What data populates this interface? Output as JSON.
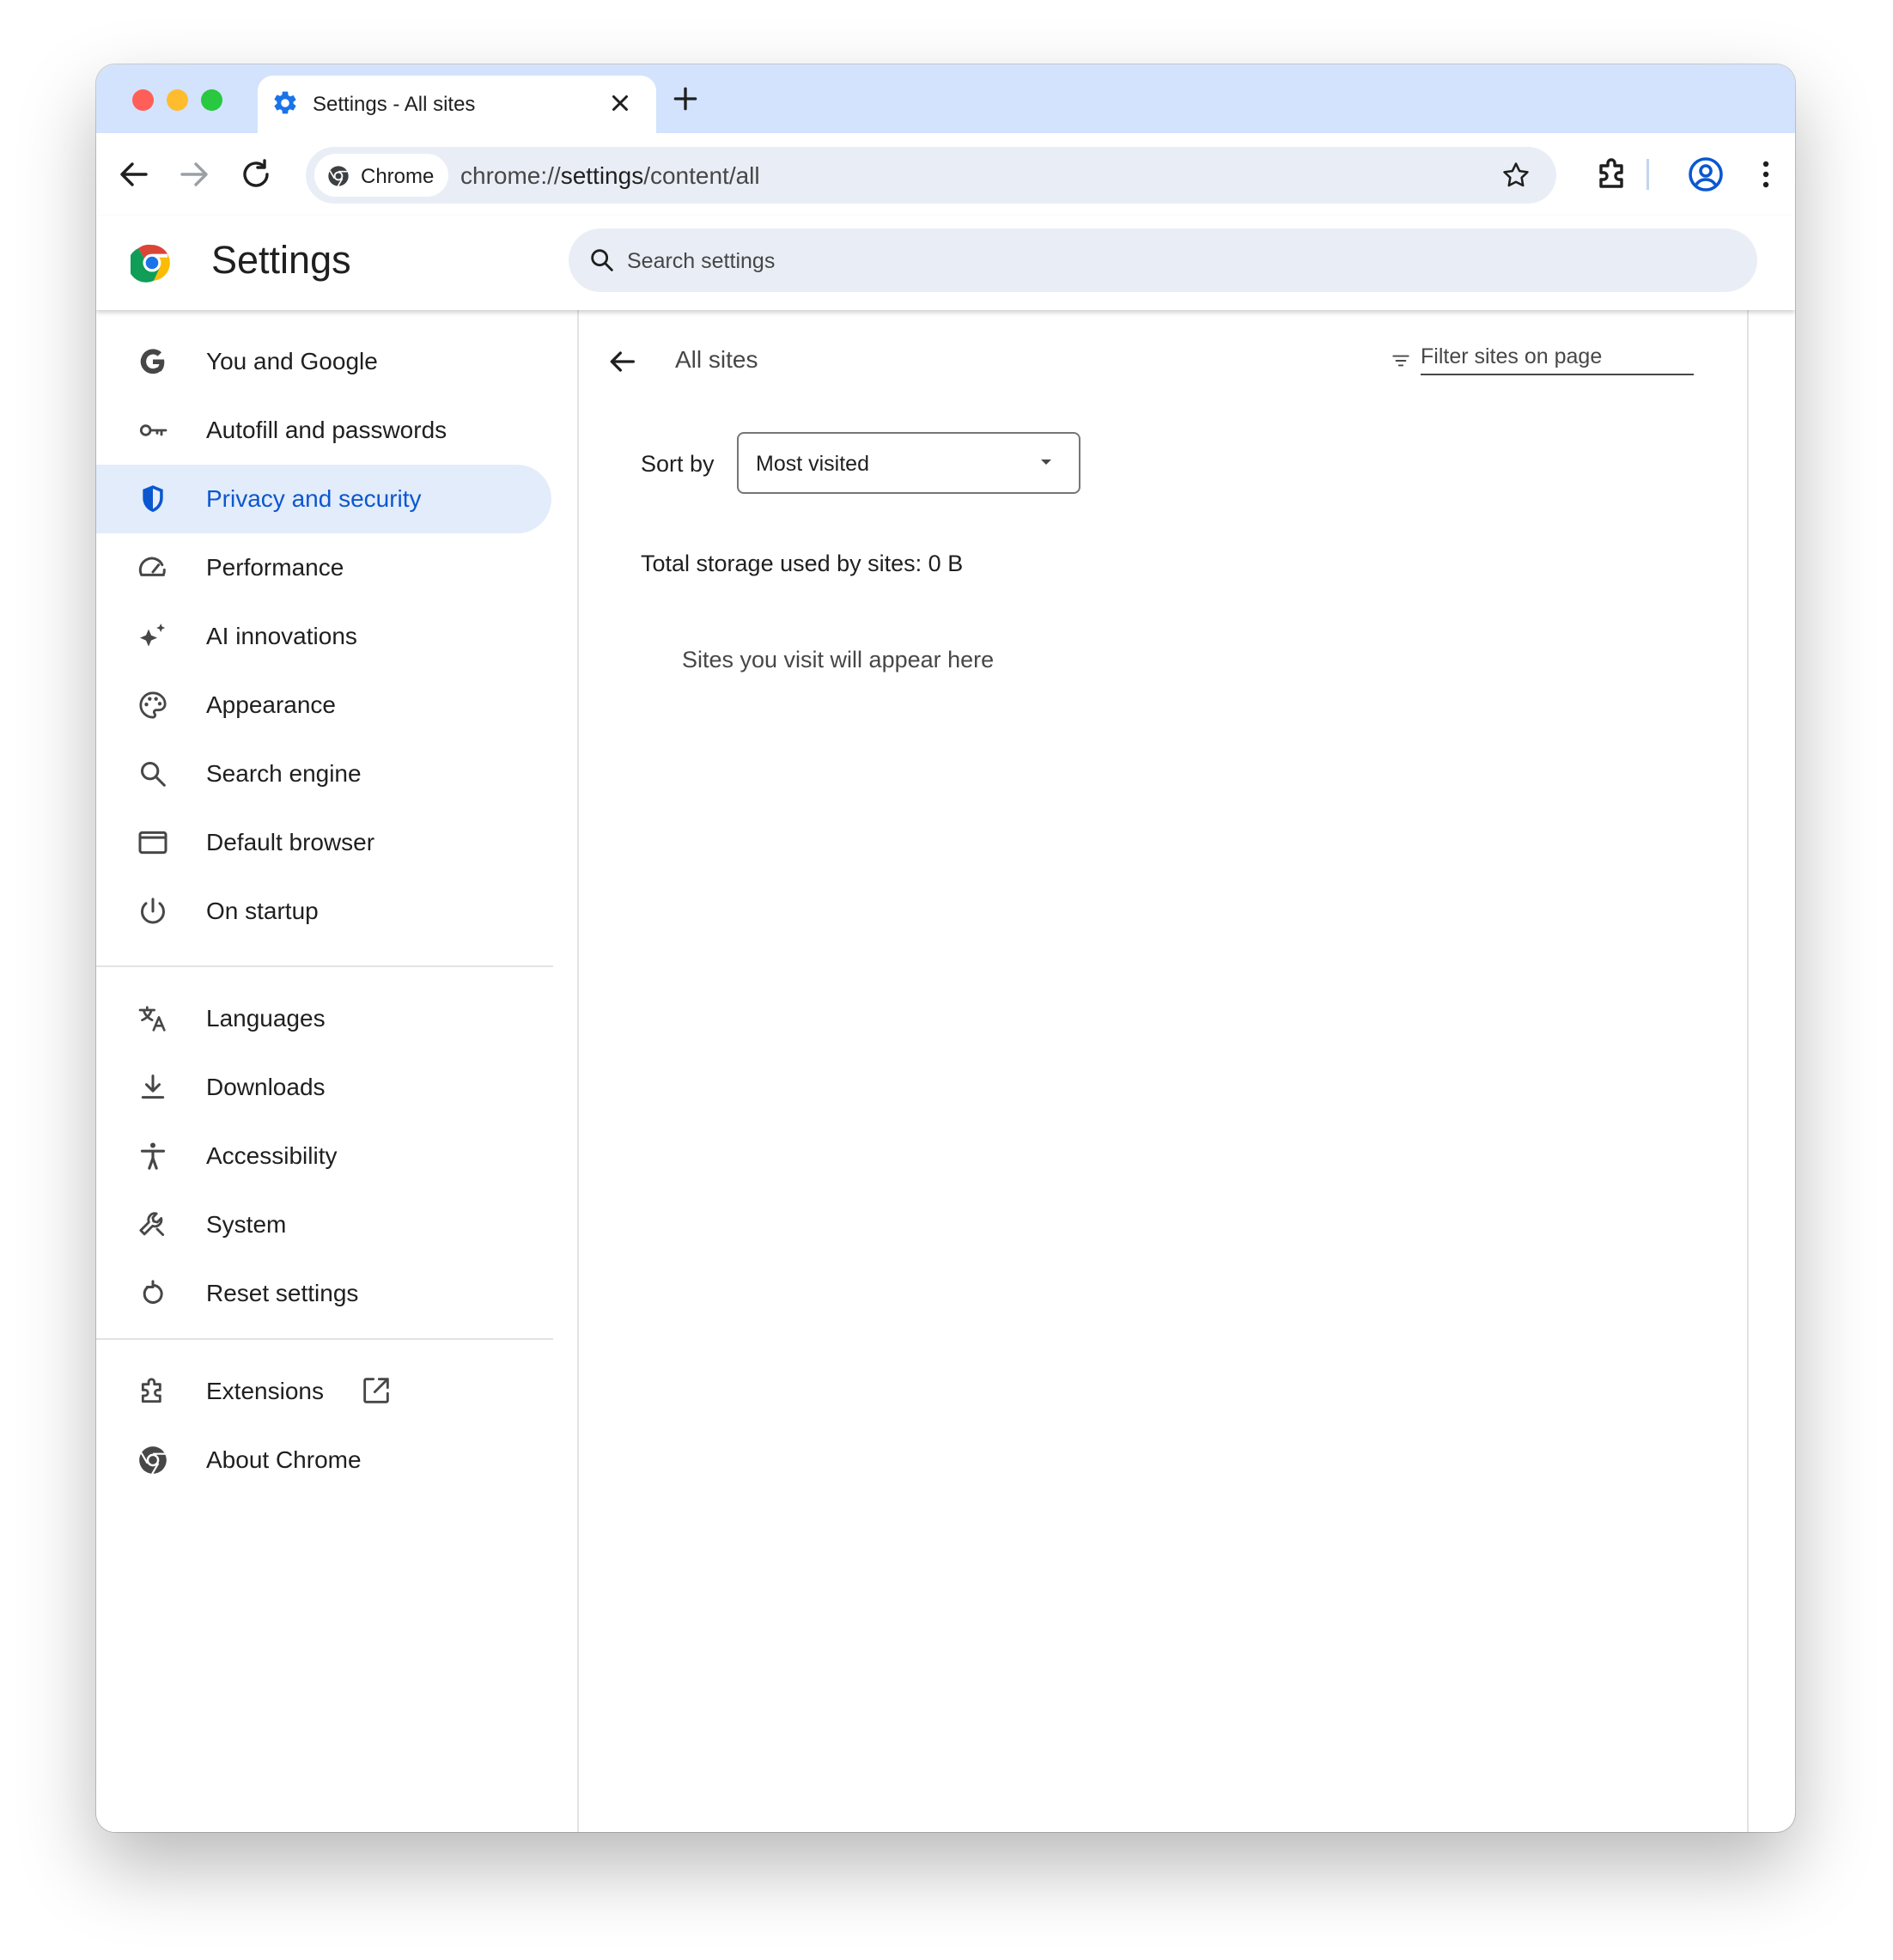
{
  "browser": {
    "tab_title": "Settings - All sites",
    "chip_label": "Chrome",
    "url_prefix": "chrome://",
    "url_host": "settings",
    "url_path": "/content/all"
  },
  "header": {
    "title": "Settings",
    "search_placeholder": "Search settings"
  },
  "sidebar": {
    "items": [
      {
        "label": "You and Google",
        "icon": "google-g-icon"
      },
      {
        "label": "Autofill and passwords",
        "icon": "key-icon"
      },
      {
        "label": "Privacy and security",
        "icon": "shield-icon",
        "active": true
      },
      {
        "label": "Performance",
        "icon": "speedometer-icon"
      },
      {
        "label": "AI innovations",
        "icon": "sparkle-icon"
      },
      {
        "label": "Appearance",
        "icon": "palette-icon"
      },
      {
        "label": "Search engine",
        "icon": "search-icon"
      },
      {
        "label": "Default browser",
        "icon": "browser-window-icon"
      },
      {
        "label": "On startup",
        "icon": "power-icon"
      },
      {
        "label": "Languages",
        "icon": "translate-icon"
      },
      {
        "label": "Downloads",
        "icon": "download-icon"
      },
      {
        "label": "Accessibility",
        "icon": "accessibility-icon"
      },
      {
        "label": "System",
        "icon": "wrench-icon"
      },
      {
        "label": "Reset settings",
        "icon": "reset-icon"
      },
      {
        "label": "Extensions",
        "icon": "puzzle-icon"
      },
      {
        "label": "About Chrome",
        "icon": "chrome-logo-icon"
      }
    ]
  },
  "main": {
    "page_title": "All sites",
    "filter_placeholder": "Filter sites on page",
    "sort_label": "Sort by",
    "sort_value": "Most visited",
    "storage_text": "Total storage used by sites: 0 B",
    "empty_text": "Sites you visit will appear here"
  },
  "colors": {
    "accent": "#0b57d0",
    "tabstrip": "#d3e3fd",
    "active_nav": "#e3ecfa"
  }
}
